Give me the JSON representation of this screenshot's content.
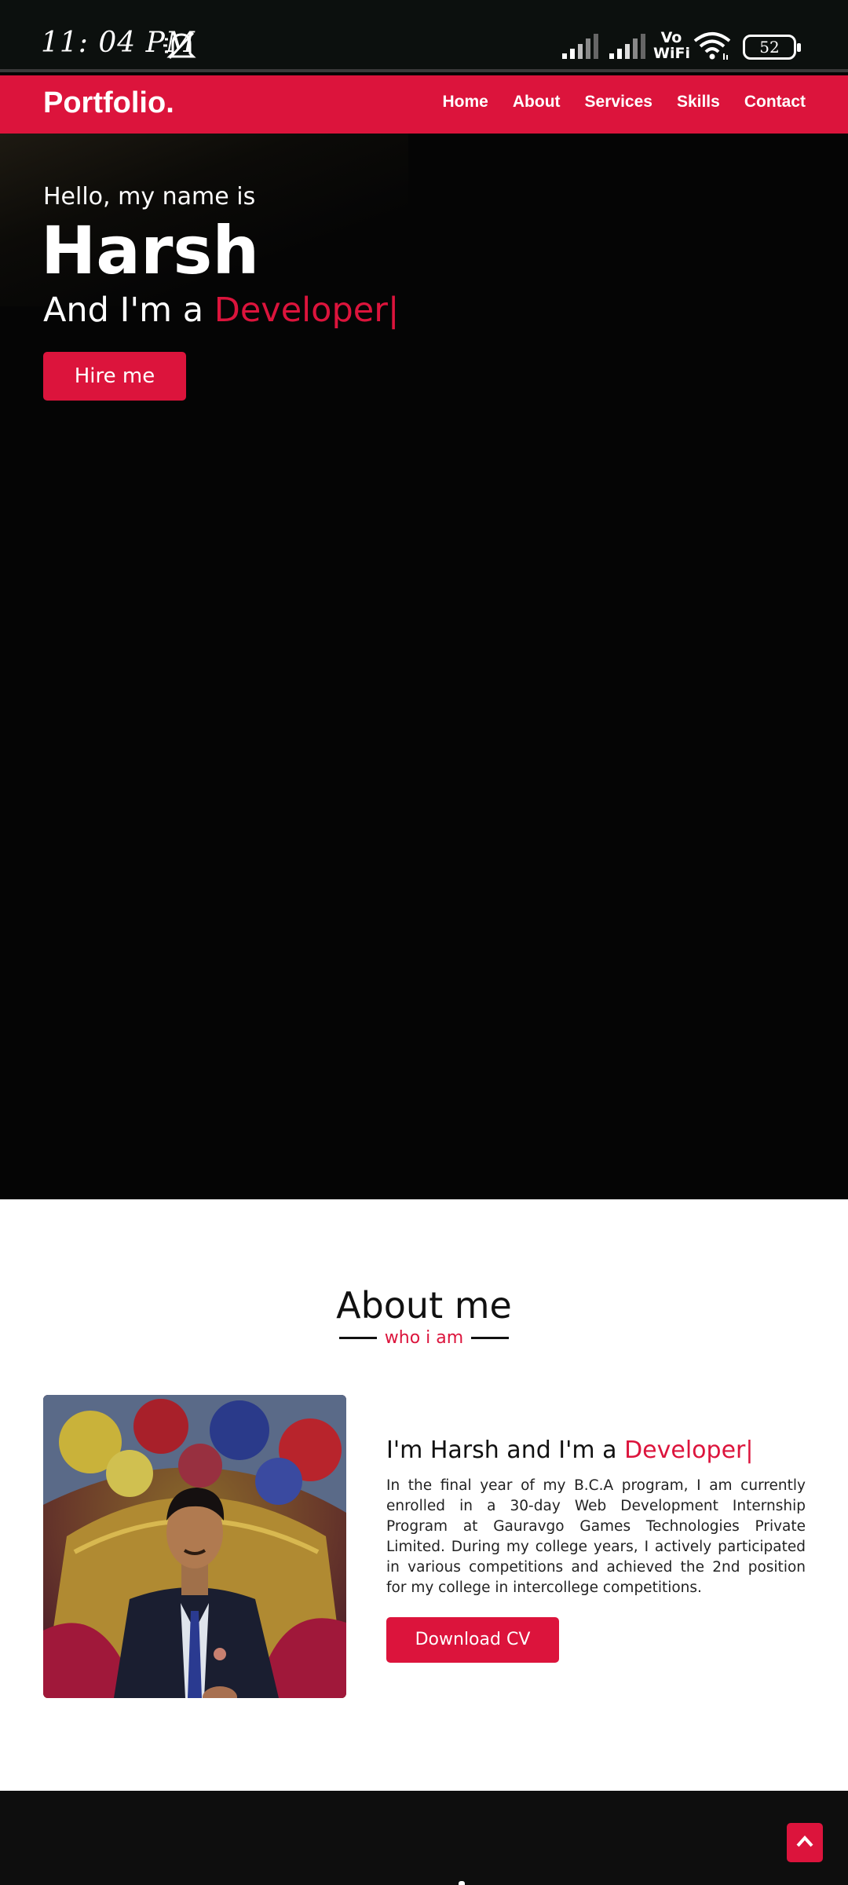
{
  "status_bar": {
    "time": "11: 04 PM",
    "vowifi_top": "Vo",
    "vowifi_bottom": "WiFi",
    "battery": "52",
    "icons": [
      "mute-bell-icon",
      "signal-icon",
      "signal-icon",
      "wifi-icon",
      "battery-icon"
    ]
  },
  "nav": {
    "brand": "Portfolio.",
    "links": [
      "Home",
      "About",
      "Services",
      "Skills",
      "Contact"
    ]
  },
  "hero": {
    "greeting": "Hello, my name is",
    "name": "Harsh",
    "role_prefix": "And I'm a ",
    "role": "Developer|",
    "cta": "Hire me"
  },
  "about": {
    "title": "About me",
    "subtitle": "who i am",
    "heading_prefix": "I'm Harsh and I'm a ",
    "heading_role": "Developer|",
    "text": "In the final year of my B.C.A program, I am currently enrolled in a 30-day Web Development Internship Program at Gauravgo Games Technologies Private Limited. During my college years, I actively participated in various competitions and achieved the 2nd position for my college in intercollege competitions.",
    "cta": "Download CV"
  },
  "colors": {
    "accent": "#dc143c",
    "hero_bg": "#050505",
    "footer_bg": "#0e0e0e"
  }
}
